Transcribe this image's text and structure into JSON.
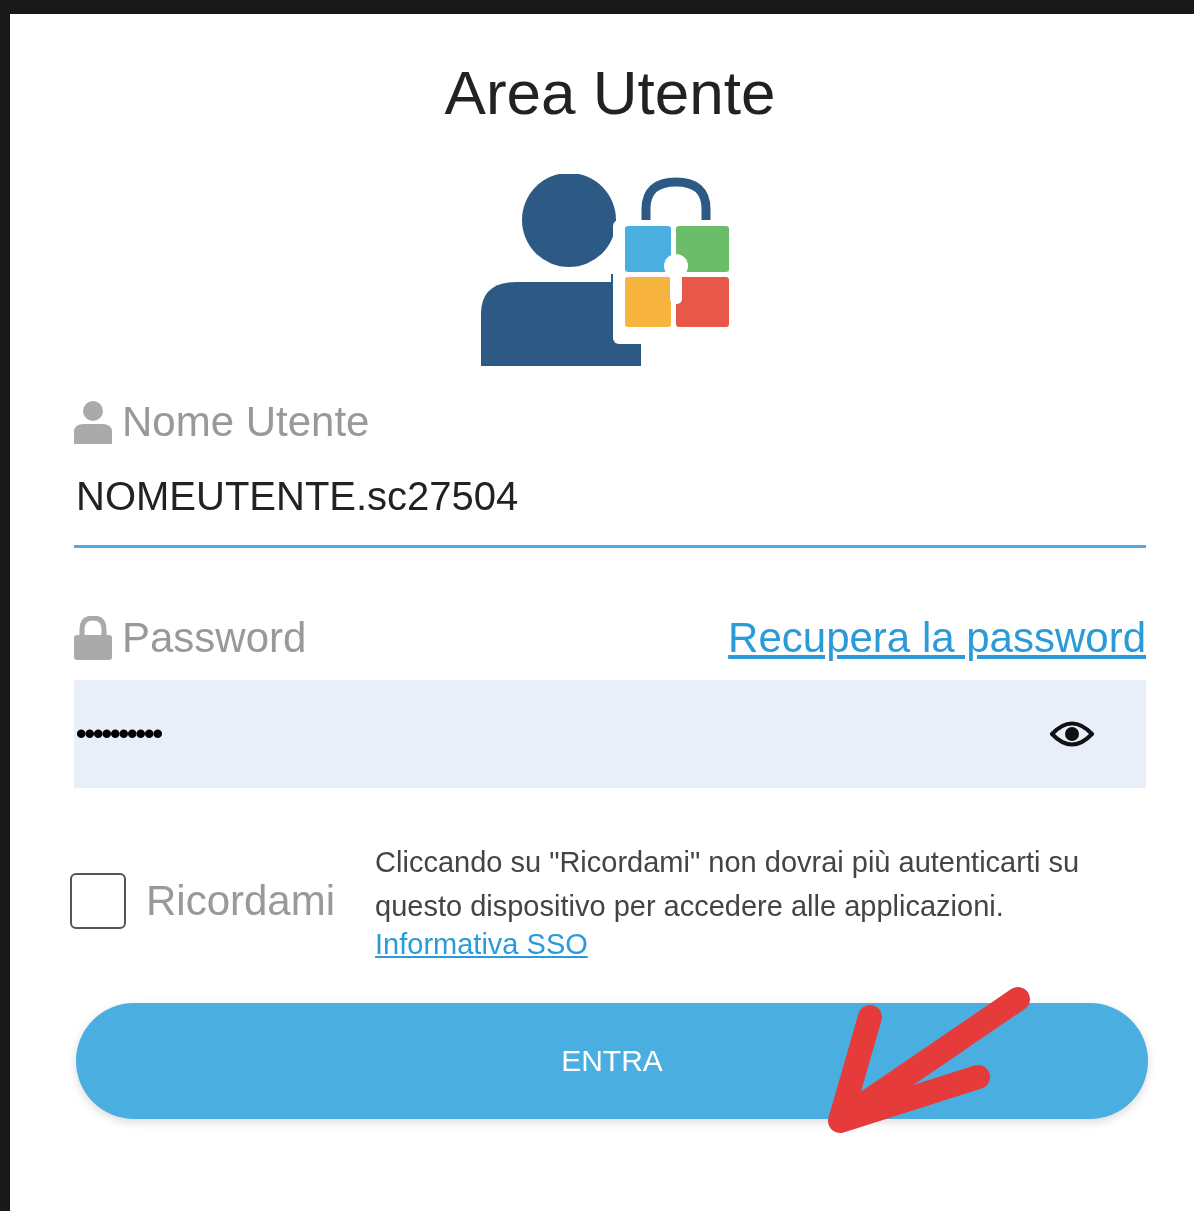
{
  "title": "Area Utente",
  "username": {
    "label": "Nome Utente",
    "value": "NOMEUTENTE.sc27504"
  },
  "password": {
    "label": "Password",
    "recover_link": "Recupera la password",
    "value": "••••••••••"
  },
  "remember": {
    "label": "Ricordami",
    "checked": false,
    "note": "Cliccando su \"Ricordami\" non dovrai più autenticarti su questo dispositivo per accedere alle applicazioni.",
    "link": "Informativa SSO"
  },
  "submit": "ENTRA"
}
